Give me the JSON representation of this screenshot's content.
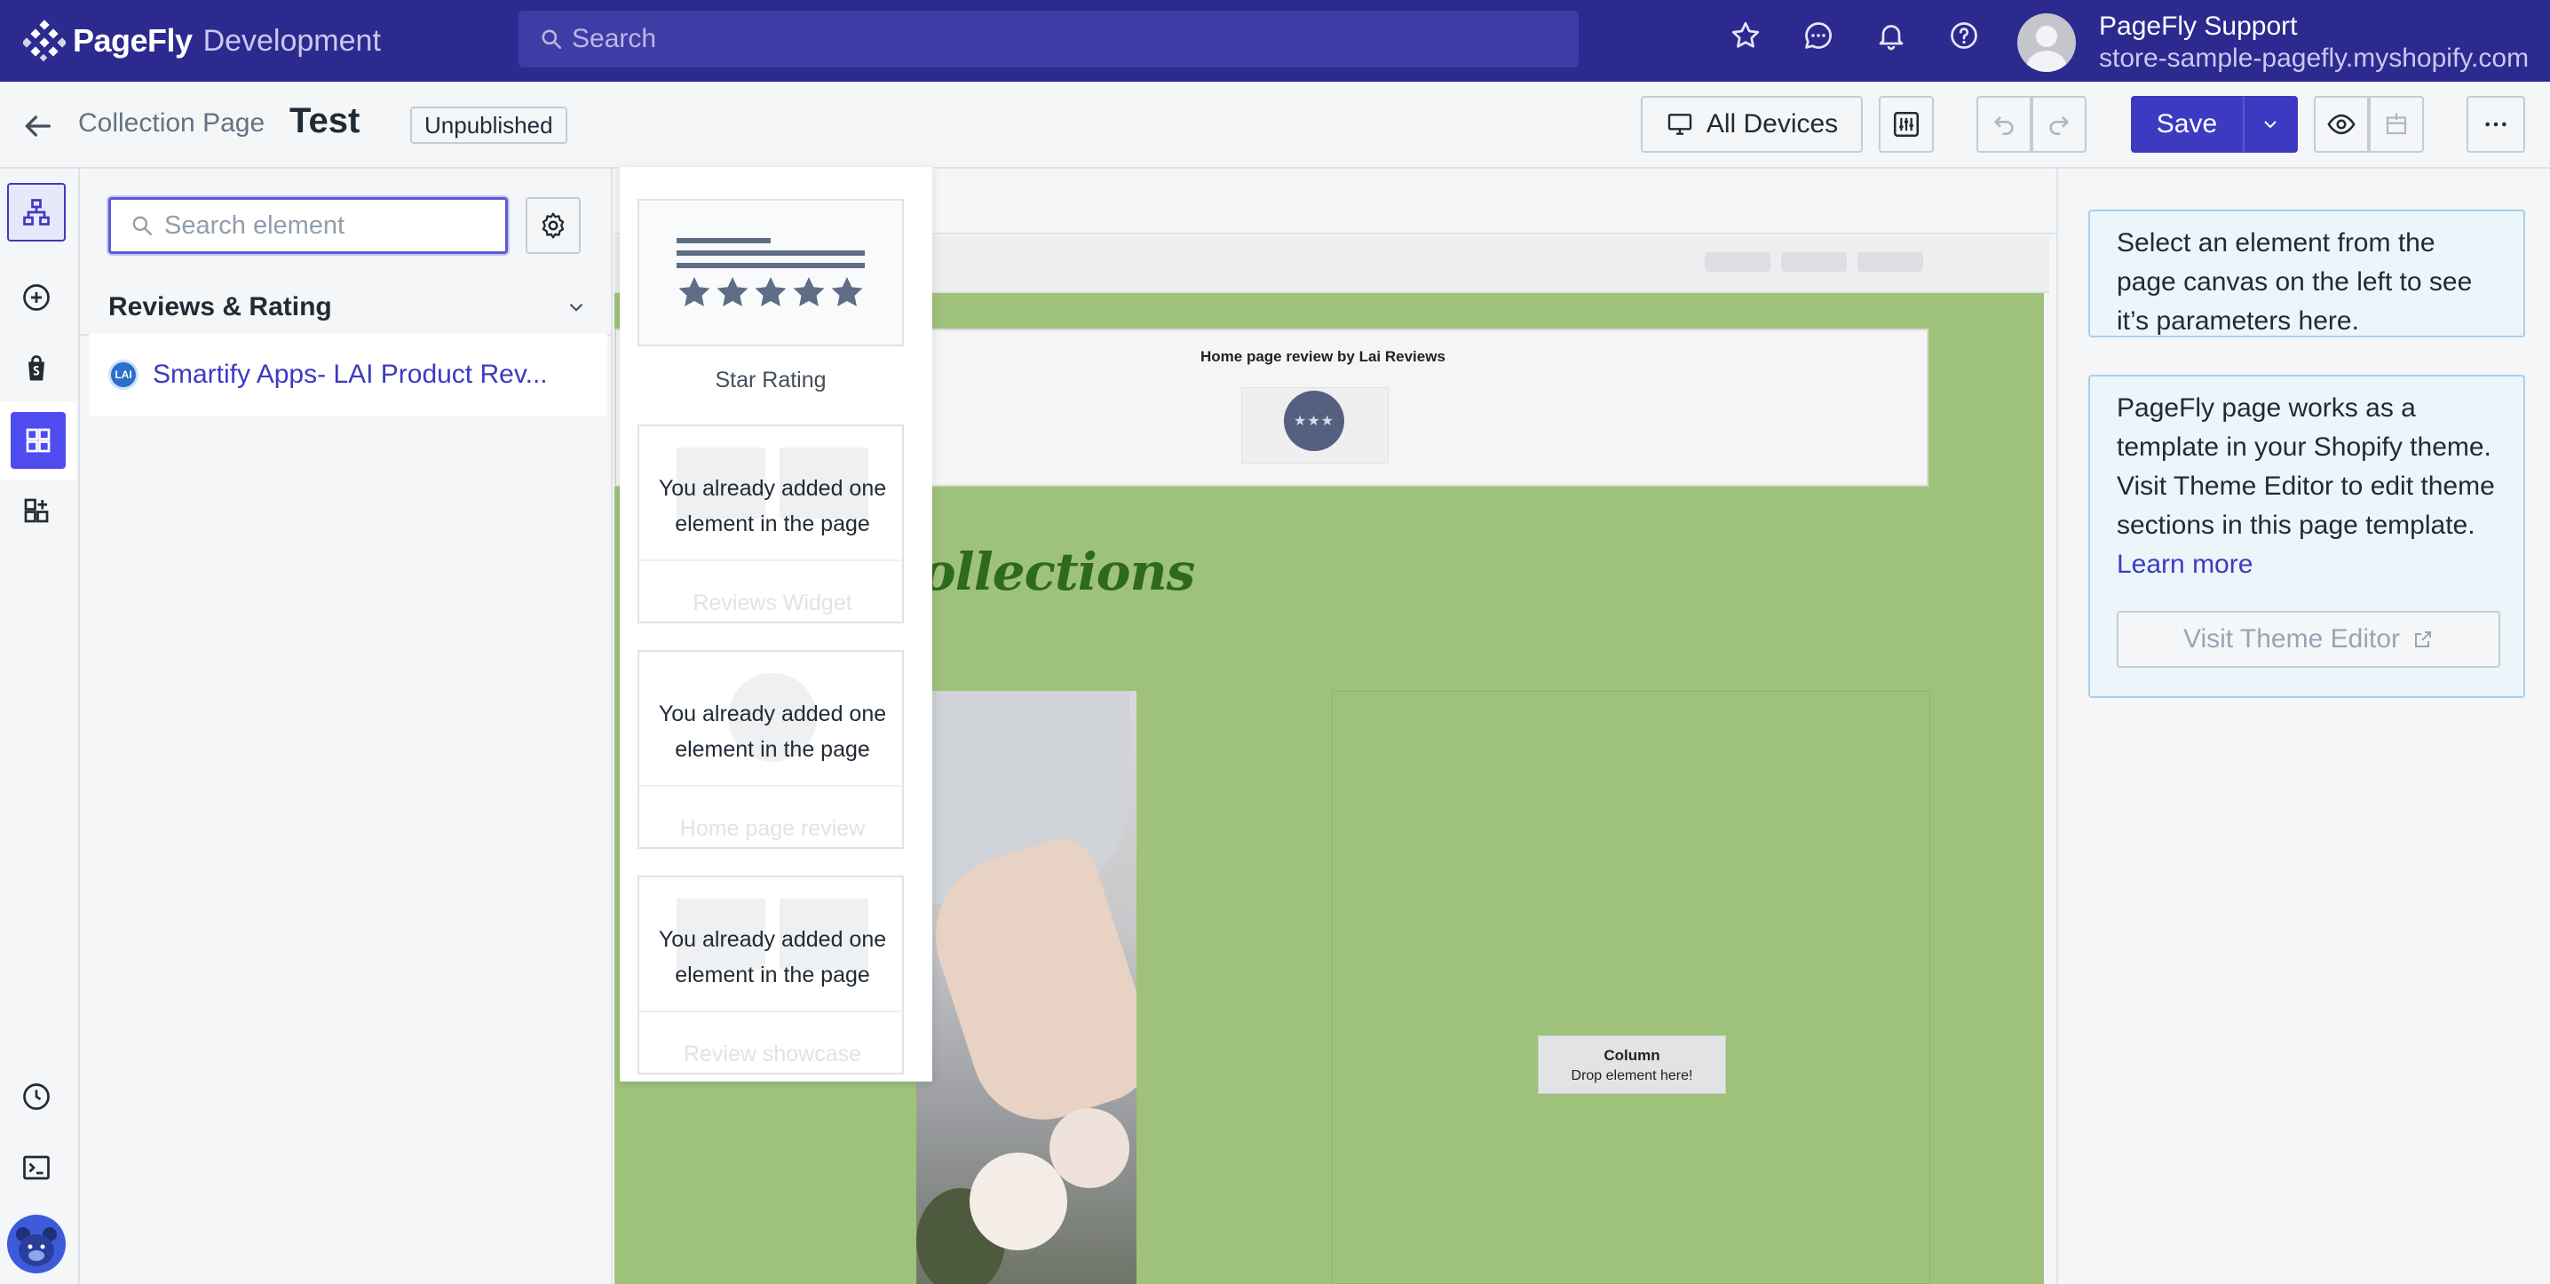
{
  "app": {
    "brand": "PageFly",
    "brand_suffix": "Development",
    "search_placeholder": "Search",
    "user_name": "PageFly Support",
    "user_store": "store-sample-pagefly.myshopify.com",
    "accent_color": "#2c2a8f"
  },
  "toolbar": {
    "breadcrumb": "Collection Page",
    "page_title": "Test",
    "status_badge": "Unpublished",
    "devices_label": "All Devices",
    "save_label": "Save"
  },
  "element_panel": {
    "search_placeholder": "Search element",
    "section_title": "Reviews & Rating",
    "app_logo_text": "LAI",
    "app_item_label": "Smartify Apps- LAI Product Rev..."
  },
  "flyout": {
    "cards": [
      {
        "label": "Star Rating",
        "disabled": false
      },
      {
        "label": "Reviews Widget",
        "disabled": true,
        "message": "You already added one element in the page"
      },
      {
        "label": "Home page review",
        "disabled": true,
        "message": "You already added one element in the page"
      },
      {
        "label": "Review showcase",
        "disabled": true,
        "message": "You already added one element in the page"
      }
    ]
  },
  "canvas": {
    "review_title": "Home page review by Lai Reviews",
    "seal_text": "★★★",
    "collections_heading": "ollections",
    "column_label": "Column",
    "column_hint": "Drop element here!",
    "page_bg_color": "#9fc27a"
  },
  "inspector": {
    "hint": "Select an element from the page canvas on the left to see it’s parameters here.",
    "template_info": "PageFly page works as a template in your Shopify theme. Visit Theme Editor to edit theme sections in this page template.",
    "learn_more": "Learn more",
    "visit_theme_editor": "Visit Theme Editor"
  }
}
